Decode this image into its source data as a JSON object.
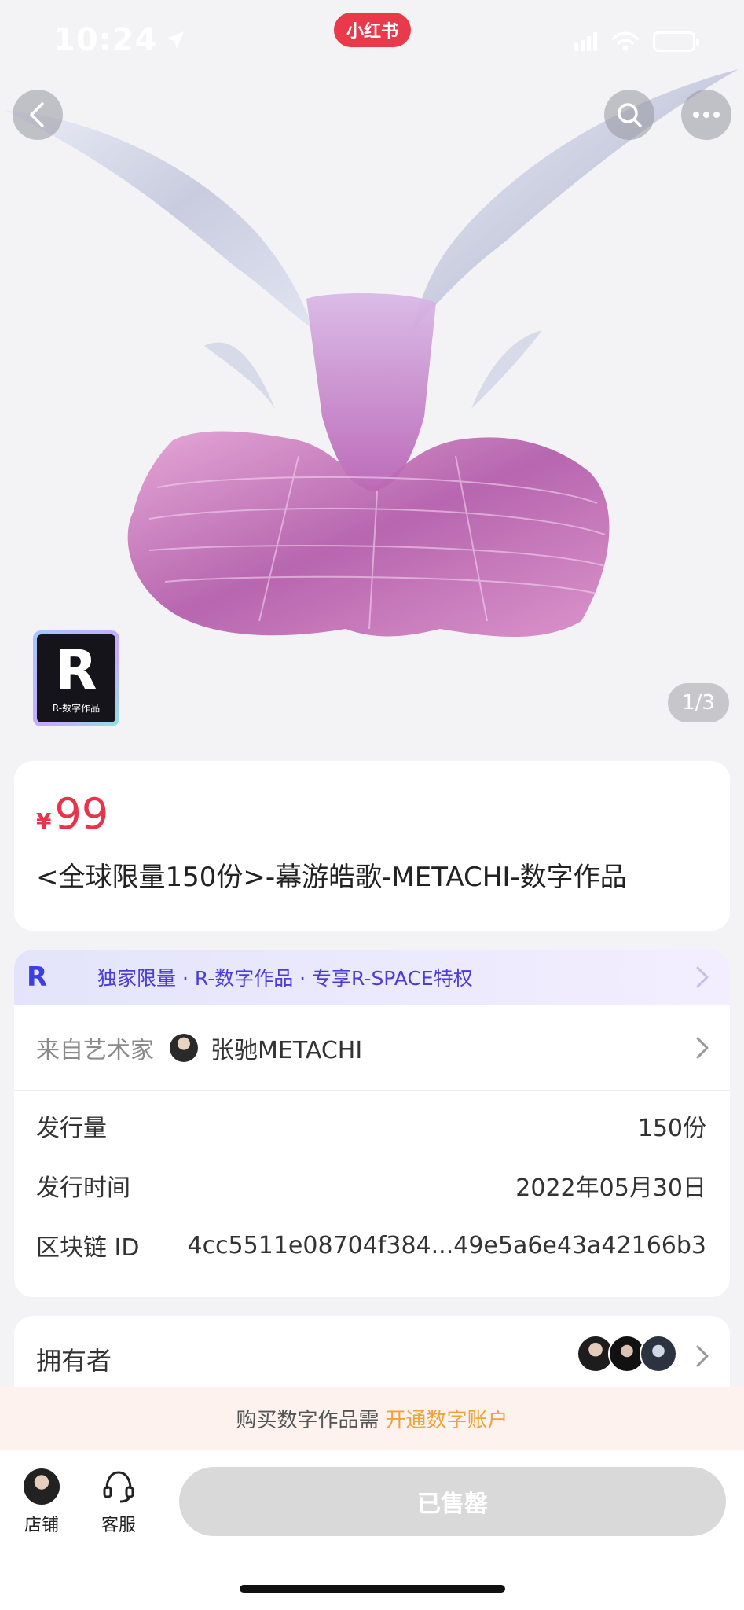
{
  "status": {
    "time": "10:24",
    "app_badge": "小红书"
  },
  "gallery": {
    "counter": "1/3",
    "badge_cap": "R-数字作品",
    "badge_letter": "R"
  },
  "product": {
    "currency": "¥",
    "price": "99",
    "title": "<全球限量150份>-幕游皓歌-METACHI-数字作品"
  },
  "banner": {
    "logo": "R",
    "text": "独家限量 · R-数字作品 · 专享R-SPACE特权"
  },
  "artist": {
    "label": "来自艺术家",
    "name": "张驰METACHI"
  },
  "details": [
    {
      "label": "发行量",
      "value": "150份"
    },
    {
      "label": "发行时间",
      "value": "2022年05月30日"
    },
    {
      "label": "区块链 ID",
      "value": "4cc5511e08704f384...49e5a6e43a42166b3"
    }
  ],
  "owners": {
    "label": "拥有者"
  },
  "notice": {
    "text": "购买数字作品需",
    "link": "开通数字账户"
  },
  "bottom": {
    "shop": "店铺",
    "service": "客服",
    "sold_out": "已售罄"
  },
  "colors": {
    "price": "#e8344a",
    "accent_link": "#f0a23a",
    "banner_text": "#4b3bd8",
    "app_red": "#e83a4a"
  }
}
